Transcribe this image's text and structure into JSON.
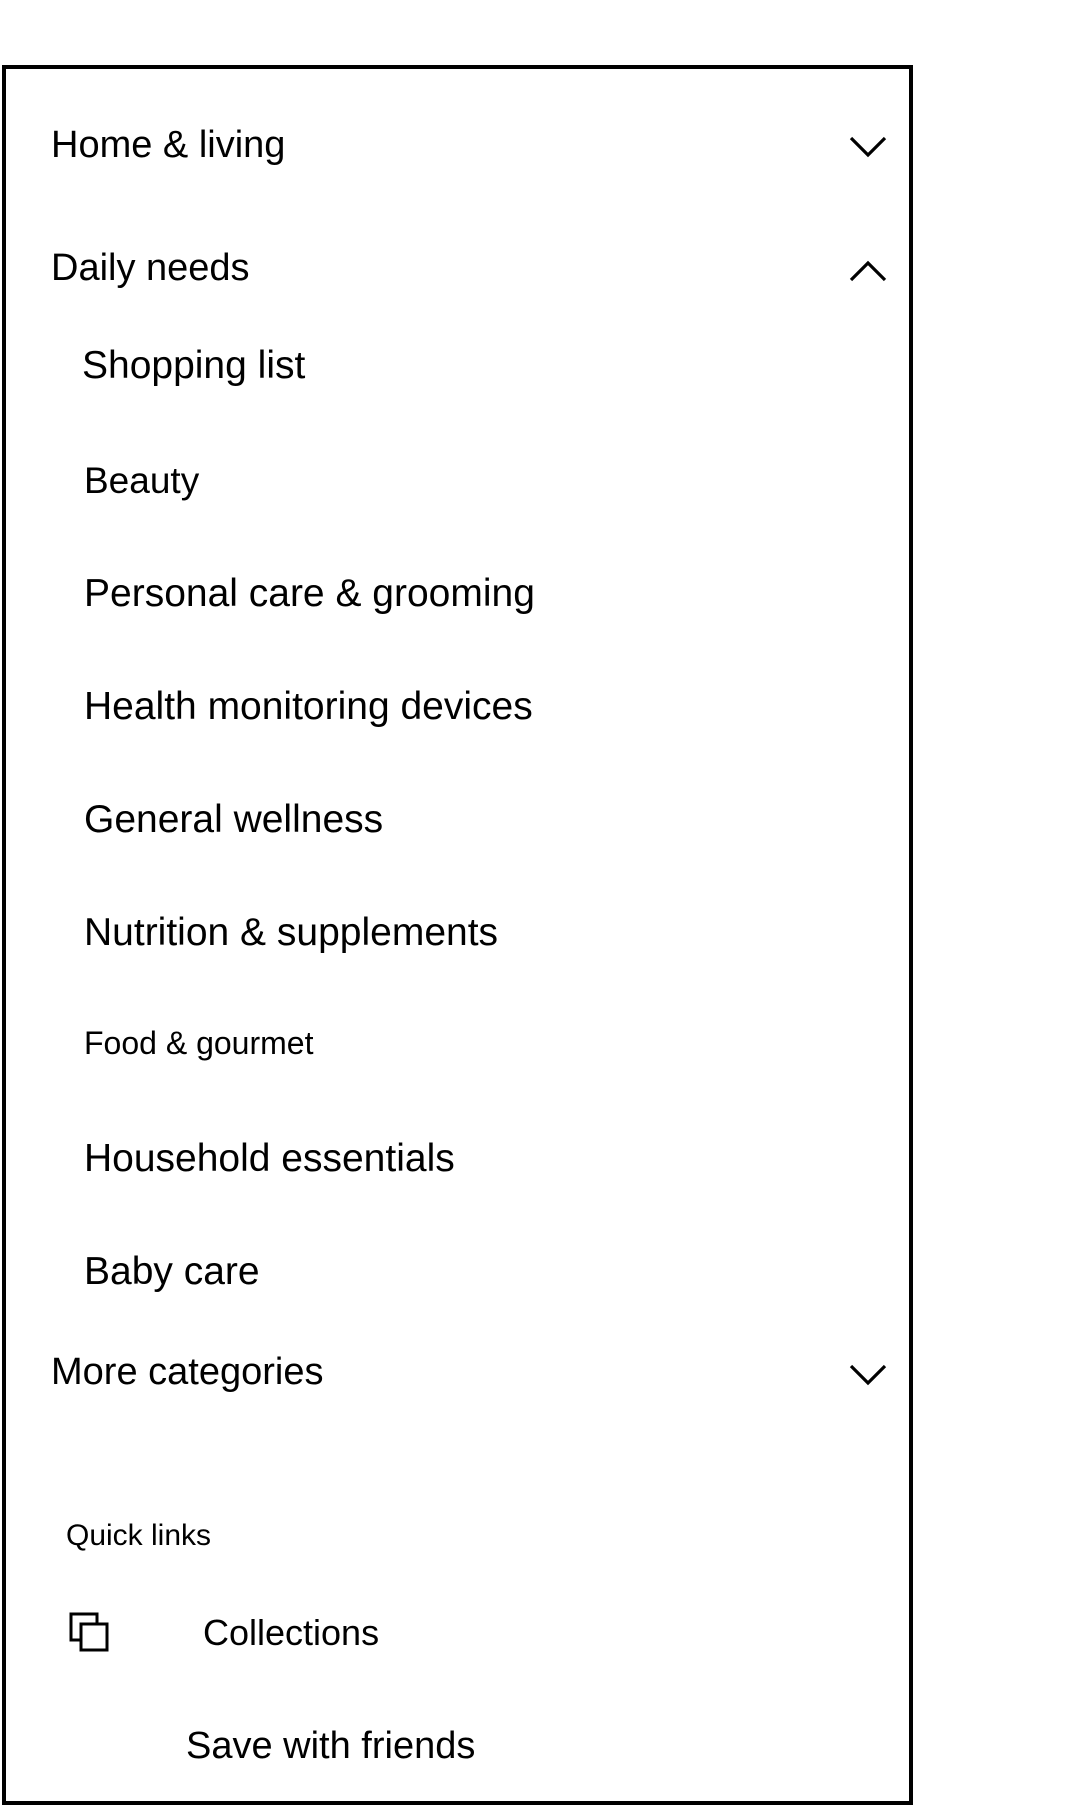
{
  "menu": {
    "sections": [
      {
        "label": "Home & living",
        "expanded": false,
        "icon": "chevron-down-icon"
      },
      {
        "label": "Daily needs",
        "expanded": true,
        "icon": "chevron-up-icon"
      },
      {
        "label": "More categories",
        "expanded": false,
        "icon": "chevron-down-icon"
      }
    ],
    "daily_needs_items": [
      "Shopping list",
      "Beauty",
      "Personal care & grooming",
      "Health monitoring devices",
      "General wellness",
      "Nutrition & supplements",
      "Food & gourmet",
      "Household essentials",
      "Baby care"
    ]
  },
  "quick_links": {
    "heading": "Quick links",
    "items": [
      {
        "label": "Collections",
        "icon": "collections-icon"
      },
      {
        "label": "Save with friends"
      }
    ]
  }
}
